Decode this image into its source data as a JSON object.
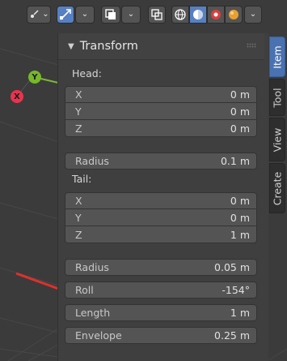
{
  "toolbar": {
    "icons": [
      "transform-pivot-icon",
      "snap-icon",
      "overlay-icon",
      "xray-icon",
      "wireframe-shading-icon",
      "solid-shading-icon",
      "material-shading-icon",
      "rendered-shading-icon"
    ],
    "active_color": "#5680c2"
  },
  "gizmo": {
    "y_label": "Y",
    "x_label": "X"
  },
  "panel": {
    "title": "Transform",
    "head": {
      "label": "Head:",
      "x_label": "X",
      "x_value": "0 m",
      "y_label": "Y",
      "y_value": "0 m",
      "z_label": "Z",
      "z_value": "0 m",
      "radius_label": "Radius",
      "radius_value": "0.1 m"
    },
    "tail": {
      "label": "Tail:",
      "x_label": "X",
      "x_value": "0 m",
      "y_label": "Y",
      "y_value": "0 m",
      "z_label": "Z",
      "z_value": "1 m",
      "radius_label": "Radius",
      "radius_value": "0.05 m"
    },
    "roll_label": "Roll",
    "roll_value": "-154°",
    "length_label": "Length",
    "length_value": "1 m",
    "envelope_label": "Envelope",
    "envelope_value": "0.25 m"
  },
  "tabs": [
    {
      "label": "Item",
      "active": true
    },
    {
      "label": "Tool",
      "active": false
    },
    {
      "label": "View",
      "active": false
    },
    {
      "label": "Create",
      "active": false
    }
  ]
}
